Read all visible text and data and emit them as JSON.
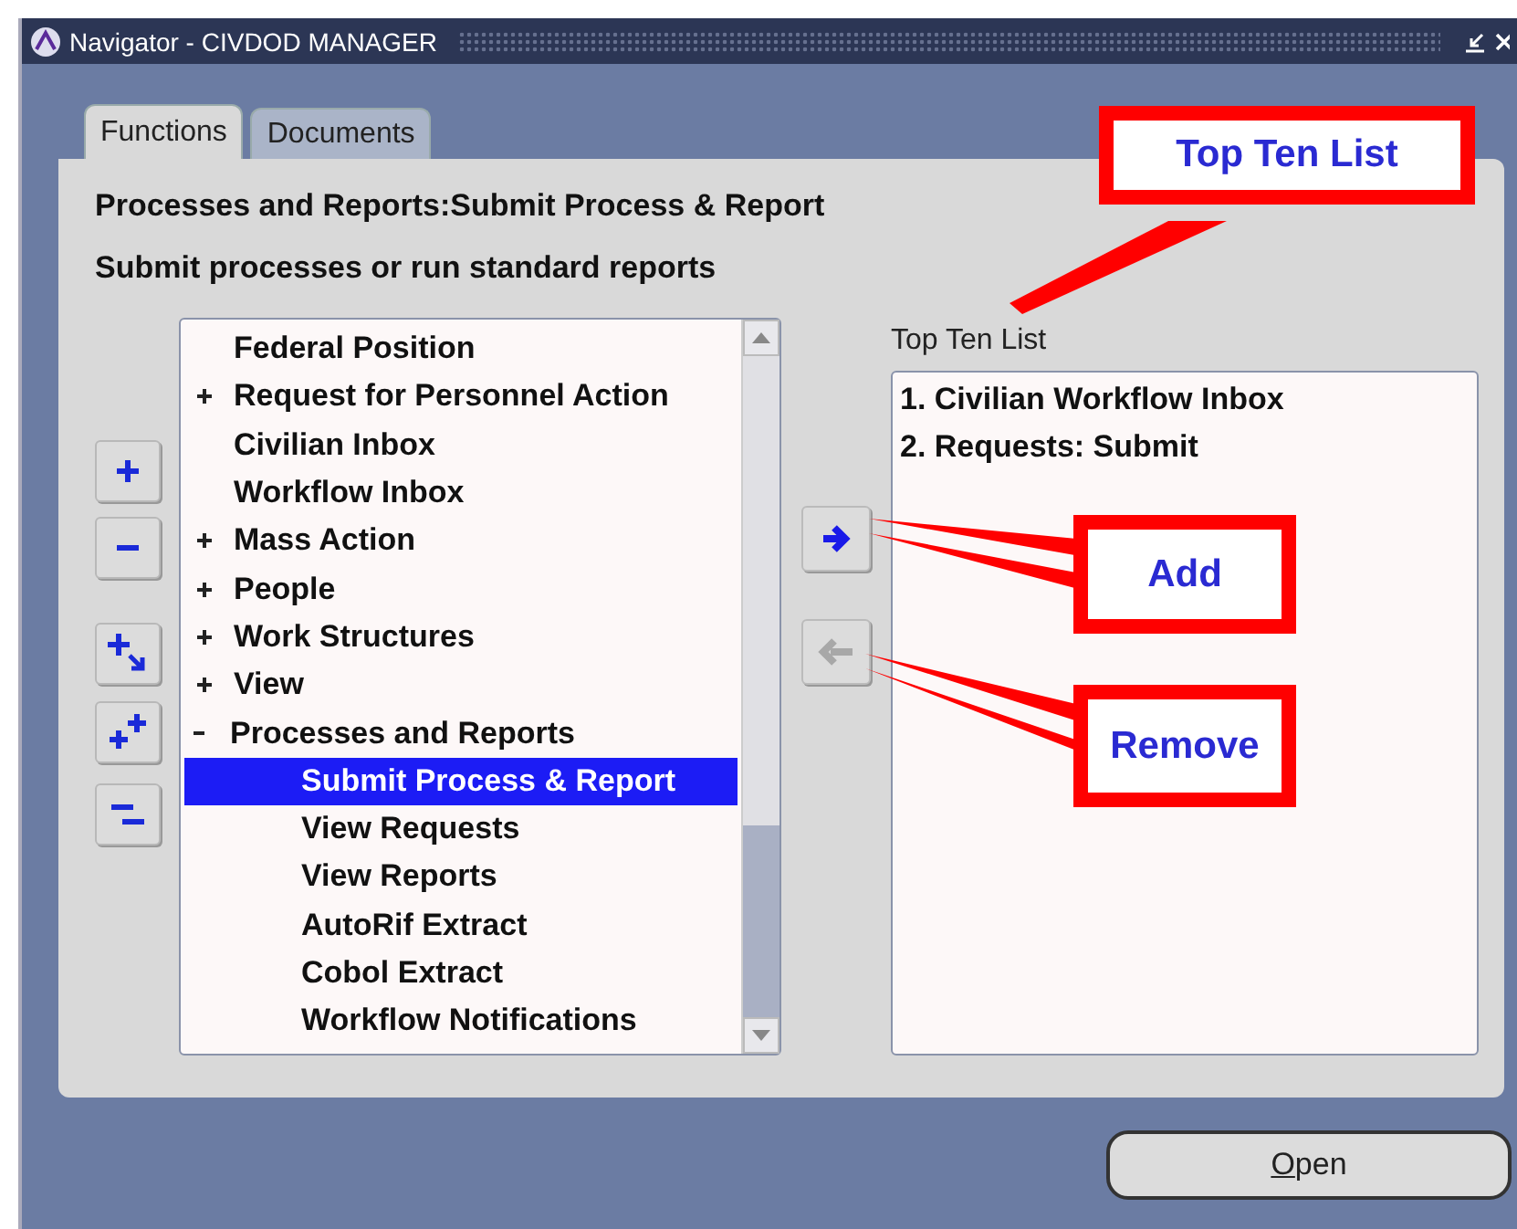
{
  "window": {
    "title": "Navigator - CIVDOD MANAGER"
  },
  "tabs": [
    {
      "label": "Functions",
      "selected": true
    },
    {
      "label": "Documents",
      "selected": false
    }
  ],
  "heading": "Processes and Reports:Submit Process & Report",
  "description": "Submit processes or run standard reports",
  "tree_buttons": [
    {
      "kind": "expand"
    },
    {
      "kind": "collapse"
    },
    {
      "kind": "expand_branch"
    },
    {
      "kind": "expand_all"
    },
    {
      "kind": "collapse_all"
    }
  ],
  "tree": [
    {
      "label": "Federal Position",
      "selected": false
    },
    {
      "label": "Request for Personnel Action",
      "selected": false,
      "expanded": false
    },
    {
      "label": "Civilian Inbox",
      "selected": false
    },
    {
      "label": "Workflow Inbox",
      "selected": false
    },
    {
      "label": "Mass Action",
      "selected": false,
      "expanded": false
    },
    {
      "label": "People",
      "selected": false,
      "expanded": false
    },
    {
      "label": "Work Structures",
      "selected": false,
      "expanded": false
    },
    {
      "label": "View",
      "selected": false,
      "expanded": false
    },
    {
      "label": "Processes and Reports",
      "selected": false,
      "expanded": true,
      "children": [
        {
          "label": "Submit Process & Report",
          "selected": true
        },
        {
          "label": "View Requests",
          "selected": false
        },
        {
          "label": "View Reports",
          "selected": false
        },
        {
          "label": "AutoRif Extract",
          "selected": false
        },
        {
          "label": "Cobol Extract",
          "selected": false
        },
        {
          "label": "Workflow Notifications",
          "selected": false
        }
      ]
    }
  ],
  "transfer_buttons": [
    {
      "kind": "add",
      "disabled": false
    },
    {
      "kind": "remove",
      "disabled": true
    }
  ],
  "top_ten": {
    "label": "Top Ten List",
    "items": [
      "1. Civilian Workflow Inbox",
      "2. Requests: Submit"
    ]
  },
  "open_button": "Open",
  "annotations": [
    {
      "kind": "top",
      "text": "Top Ten List"
    },
    {
      "kind": "add",
      "text": "Add"
    },
    {
      "kind": "remove",
      "text": "Remove"
    }
  ]
}
